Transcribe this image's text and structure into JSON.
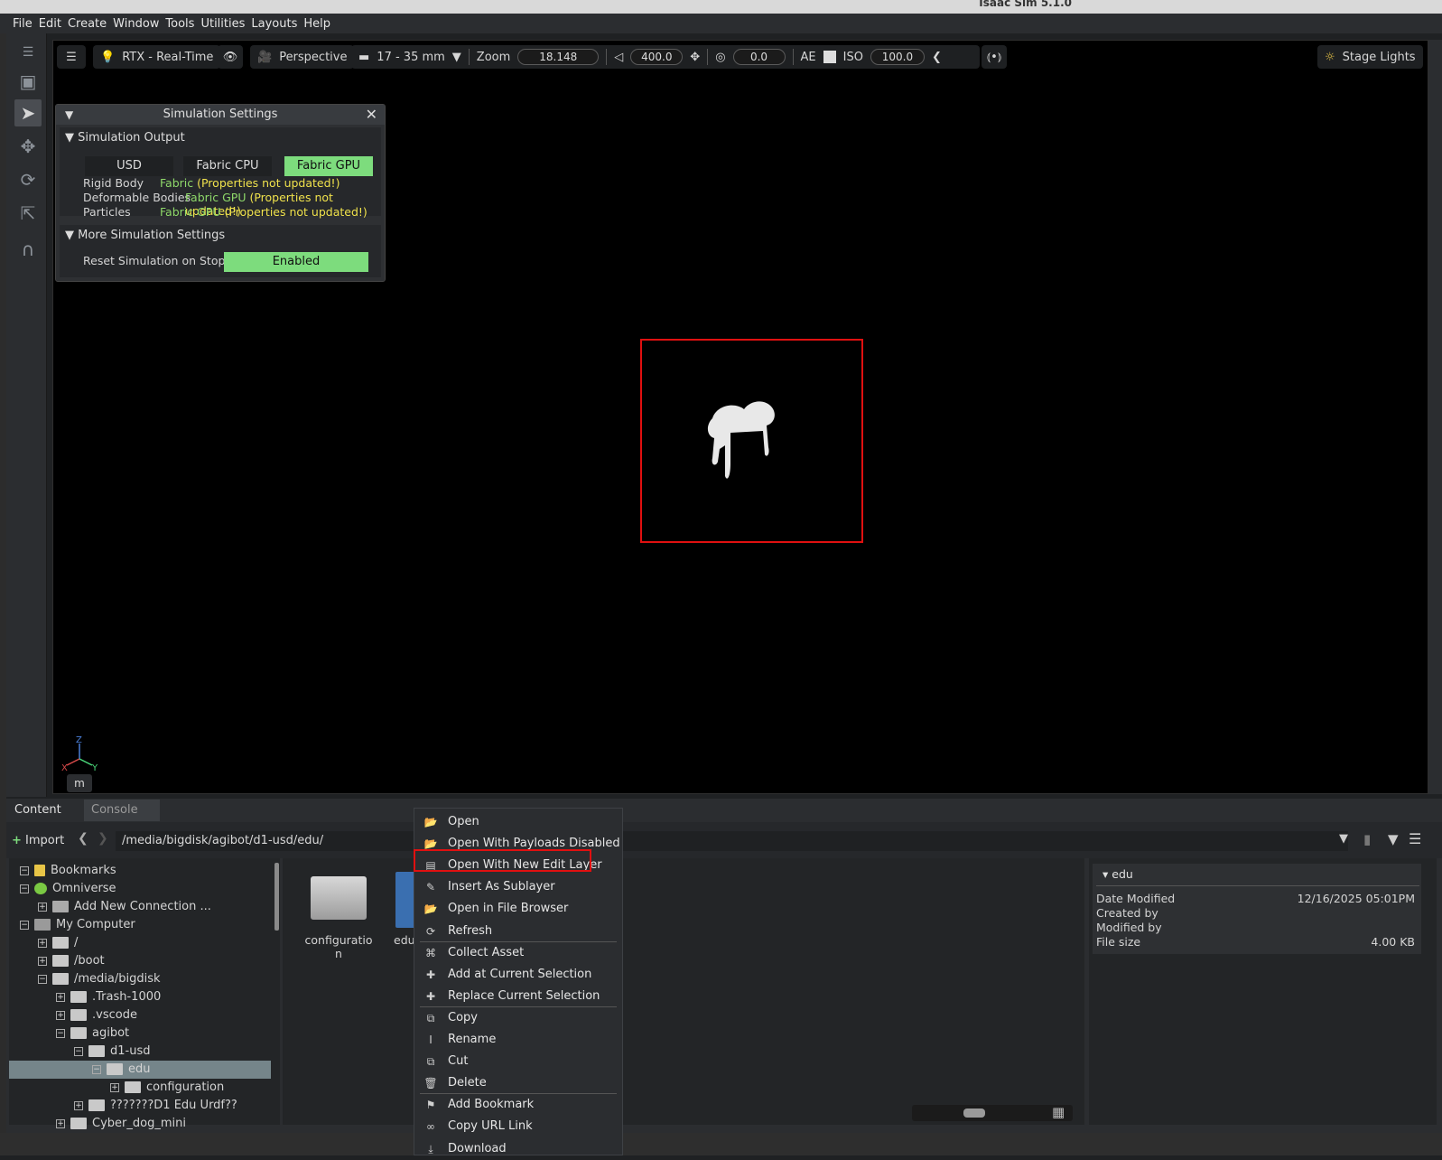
{
  "window": {
    "title": "Isaac Sim 5.1.0"
  },
  "menubar": [
    "File",
    "Edit",
    "Create",
    "Window",
    "Tools",
    "Utilities",
    "Layouts",
    "Help"
  ],
  "viewport": {
    "renderer": "RTX - Real-Time",
    "camera": "Perspective",
    "lens": "17 - 35 mm",
    "zoom_label": "Zoom",
    "zoom_value": "18.148",
    "speed_value": "400.0",
    "aperture_value": "0.0",
    "ae_label": "AE",
    "iso_label": "ISO",
    "iso_value": "100.0",
    "lighting": "Stage Lights",
    "unit": "m",
    "axis": {
      "z": "Z",
      "x": "X",
      "y": "Y"
    }
  },
  "simulation_settings": {
    "title": "Simulation Settings",
    "output_section": "Simulation Output",
    "modes": [
      "USD",
      "Fabric CPU",
      "Fabric GPU"
    ],
    "selected_mode": "Fabric GPU",
    "rows": [
      {
        "label": "Rigid Body",
        "value": "Fabric",
        "note": "(Properties not updated!)"
      },
      {
        "label": "Deformable Bodies",
        "value": "Fabric GPU",
        "note": "(Properties not updated!)"
      },
      {
        "label": "Particles",
        "value": "Fabric GPU",
        "note": "(Properties not updated!)"
      }
    ],
    "more_section": "More Simulation Settings",
    "reset_label": "Reset Simulation on Stop",
    "reset_value": "Enabled"
  },
  "content": {
    "tabs": [
      "Content",
      "Console"
    ],
    "import_label": "Import",
    "path": "/media/bigdisk/agibot/d1-usd/edu/",
    "tree": [
      {
        "label": "Bookmarks",
        "indent": 0
      },
      {
        "label": "Omniverse",
        "indent": 0
      },
      {
        "label": "Add New Connection ...",
        "indent": 1
      },
      {
        "label": "My Computer",
        "indent": 0
      },
      {
        "label": "/",
        "indent": 1
      },
      {
        "label": "/boot",
        "indent": 1
      },
      {
        "label": "/media/bigdisk",
        "indent": 1
      },
      {
        "label": ".Trash-1000",
        "indent": 2
      },
      {
        "label": ".vscode",
        "indent": 2
      },
      {
        "label": "agibot",
        "indent": 2
      },
      {
        "label": "d1-usd",
        "indent": 3
      },
      {
        "label": "edu",
        "indent": 4
      },
      {
        "label": "configuration",
        "indent": 5
      },
      {
        "label": "???????D1 Edu Urdf??",
        "indent": 3
      },
      {
        "label": "Cyber_dog_mini",
        "indent": 2
      }
    ],
    "selected_tree_item": "edu",
    "grid_items": [
      {
        "label_line1": "configuratio",
        "label_line2": "n"
      },
      {
        "label_line1": "edu",
        "label_line2": ""
      }
    ],
    "details": {
      "name": "edu",
      "rows": [
        {
          "label": "Date Modified",
          "value": "12/16/2025 05:01PM"
        },
        {
          "label": "Created by",
          "value": ""
        },
        {
          "label": "Modified by",
          "value": ""
        },
        {
          "label": "File size",
          "value": "4.00 KB"
        }
      ]
    }
  },
  "context_menu": {
    "items": [
      {
        "icon": "folder-open-icon",
        "label": "Open"
      },
      {
        "icon": "folder-open-icon",
        "label": "Open With Payloads Disabled"
      },
      {
        "icon": "layer-icon",
        "label": "Open With New Edit Layer",
        "highlighted": true
      },
      {
        "icon": "edit-icon",
        "label": "Insert As Sublayer"
      },
      {
        "icon": "folder-open-icon",
        "label": "Open in File Browser"
      },
      {
        "icon": "refresh-icon",
        "label": "Refresh"
      },
      {
        "icon": "collect-icon",
        "label": "Collect Asset"
      },
      {
        "icon": "plus-icon",
        "label": "Add at Current Selection"
      },
      {
        "icon": "plus-icon",
        "label": "Replace Current Selection"
      },
      {
        "icon": "copy-icon",
        "label": "Copy"
      },
      {
        "icon": "rename-icon",
        "label": "Rename"
      },
      {
        "icon": "cut-icon",
        "label": "Cut"
      },
      {
        "icon": "trash-icon",
        "label": "Delete"
      },
      {
        "icon": "bookmark-icon",
        "label": "Add Bookmark"
      },
      {
        "icon": "link-icon",
        "label": "Copy URL Link"
      },
      {
        "icon": "download-icon",
        "label": "Download"
      }
    ]
  },
  "colors": {
    "accent_green": "#7ddc7d",
    "highlight_red": "#e01010",
    "warning_yellow": "#f0e24c"
  }
}
